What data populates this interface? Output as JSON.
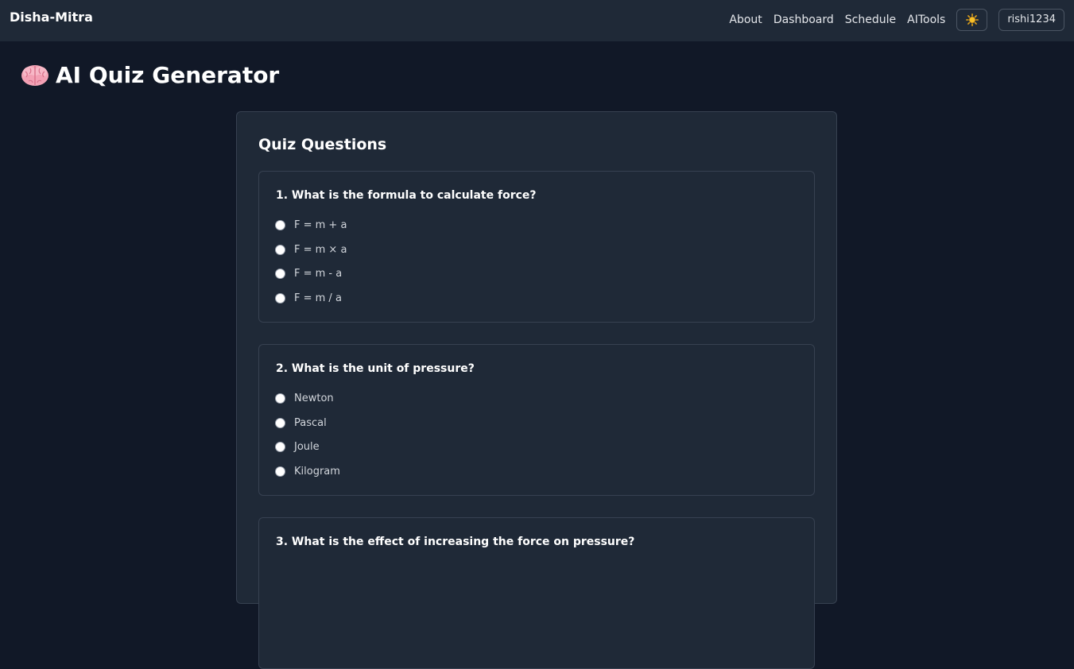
{
  "navbar": {
    "brand": "Disha-Mitra",
    "links": [
      "About",
      "Dashboard",
      "Schedule",
      "AITools"
    ],
    "theme_icon": "sun-icon",
    "user": "rishi1234"
  },
  "page": {
    "title_icon": "brain-icon",
    "title": "AI Quiz Generator"
  },
  "quiz": {
    "heading": "Quiz Questions",
    "questions": [
      {
        "text": "1. What is the formula to calculate force?",
        "options": [
          "F = m + a",
          "F = m × a",
          "F = m - a",
          "F = m / a"
        ]
      },
      {
        "text": "2. What is the unit of pressure?",
        "options": [
          "Newton",
          "Pascal",
          "Joule",
          "Kilogram"
        ]
      },
      {
        "text": "3. What is the effect of increasing the force on pressure?",
        "options": []
      }
    ]
  }
}
